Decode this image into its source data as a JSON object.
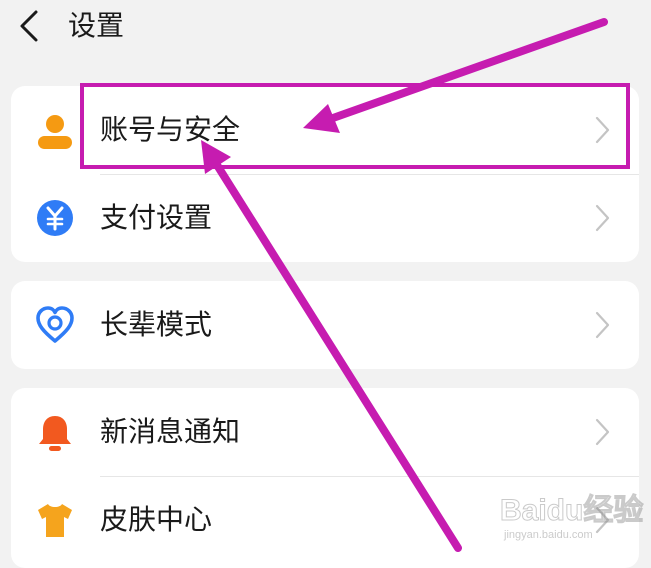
{
  "header": {
    "title": "设置"
  },
  "groups": [
    {
      "items": [
        {
          "label": "账号与安全",
          "icon": "user-icon",
          "color": "#f59a12"
        },
        {
          "label": "支付设置",
          "icon": "yuan-icon",
          "color": "#2f7cf6"
        }
      ]
    },
    {
      "items": [
        {
          "label": "长辈模式",
          "icon": "heart-care-icon",
          "color": "#2f7cf6"
        }
      ]
    },
    {
      "items": [
        {
          "label": "新消息通知",
          "icon": "bell-icon",
          "color": "#f2591f"
        },
        {
          "label": "皮肤中心",
          "icon": "tshirt-icon",
          "color": "#f5a41d"
        }
      ]
    }
  ],
  "annotation": {
    "color": "#c61cb0",
    "highlighted_item": "账号与安全"
  },
  "watermark": {
    "text": "Baidu经验",
    "subtext": "jingyan.baidu.com"
  },
  "colors": {
    "background": "#f2f2f2",
    "card": "#ffffff",
    "text": "#1a1a1a",
    "chevron": "#c4c4c4"
  }
}
